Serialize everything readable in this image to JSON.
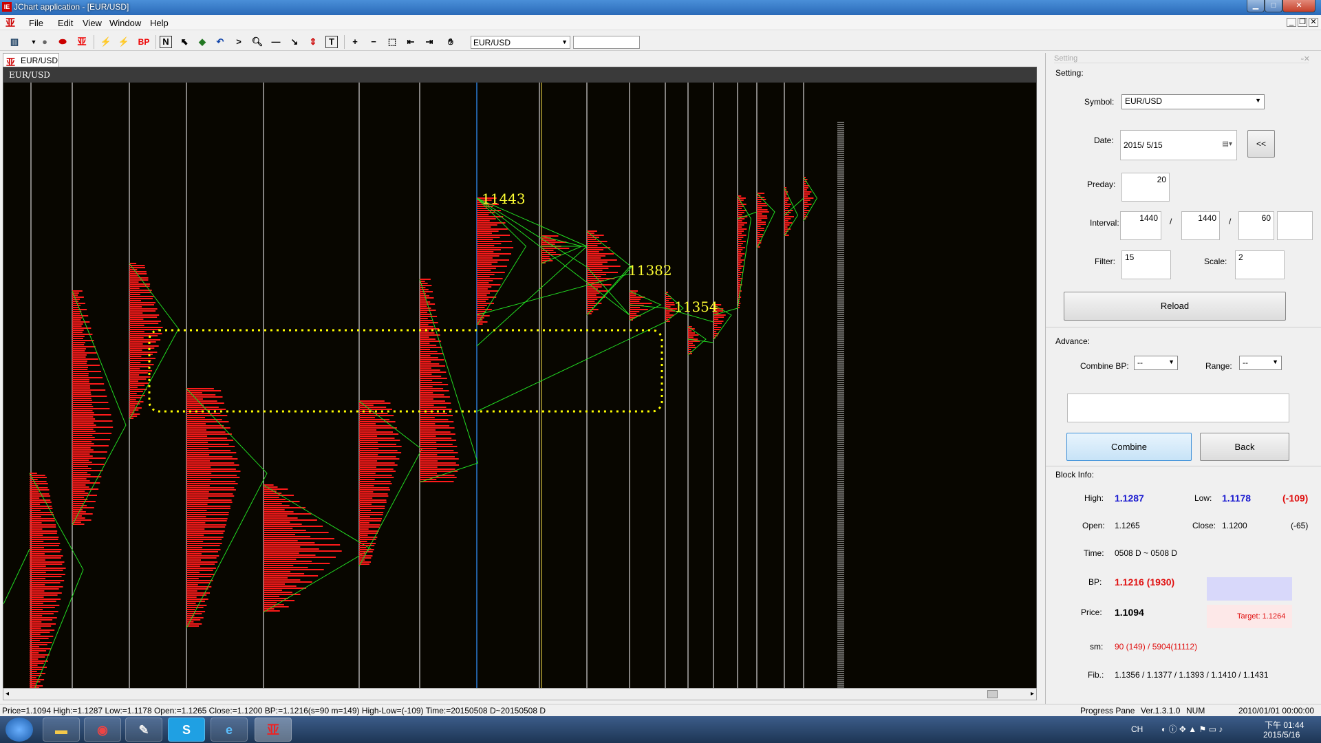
{
  "window": {
    "title": "JChart application - [EUR/USD]",
    "logo": "IE"
  },
  "menu": [
    "File",
    "Edit",
    "View",
    "Window",
    "Help"
  ],
  "toolbar": {
    "symbol": "EUR/USD",
    "input_value": "",
    "icons": [
      "chart-icon",
      "circle-icon",
      "stop-icon",
      "ie-icon",
      "lightning-icon",
      "lightning-red-icon",
      "bp-icon",
      "n-icon",
      "cursor-icon",
      "book-icon",
      "undo-icon",
      "arrow-icon",
      "zoom-icon",
      "hline-icon",
      "diag-line-icon",
      "fib-icon",
      "text-icon",
      "plus-icon",
      "minus-icon",
      "box-icon",
      "left-arrow-icon",
      "right-arrow-icon",
      "hand-icon"
    ],
    "bp_label": "BP",
    "n_label": "N",
    "t_label": "T"
  },
  "doc_tab": {
    "label": "EUR/USD"
  },
  "chart": {
    "header": "EUR/USD",
    "annotations": [
      {
        "text": "11443"
      },
      {
        "text": "11382"
      },
      {
        "text": "11354"
      }
    ],
    "colors": {
      "background": "#080600",
      "bars": "#ff1a1a",
      "lines": "#22dd22",
      "grid": "#ffffff",
      "highlight": "#ffff00",
      "current": "#2a7bd6",
      "annotation": "#ffff33"
    }
  },
  "panel": {
    "header": "Setting",
    "setting_label": "Setting:",
    "symbol_label": "Symbol:",
    "symbol_value": "EUR/USD",
    "date_label": "Date:",
    "date_value": "2015/  5/15",
    "date_back_button": "<<",
    "preday_label": "Preday:",
    "preday_value": "20",
    "interval_label": "Interval:",
    "interval_values": [
      "1440",
      "1440",
      "60",
      ""
    ],
    "interval_sep": "/",
    "filter_label": "Filter:",
    "filter_value": "15",
    "scale_label": "Scale:",
    "scale_value": "2",
    "reload_button": "Reload",
    "advance_label": "Advance:",
    "combine_bp_label": "Combine BP:",
    "combine_bp_value": "--",
    "range_label": "Range:",
    "range_value": "--",
    "combine_button": "Combine",
    "back_button": "Back",
    "block_info_label": "Block Info:",
    "high_label": "High:",
    "high_value": "1.1287",
    "low_label": "Low:",
    "low_value": "1.1178",
    "low_diff": "(-109)",
    "open_label": "Open:",
    "open_value": "1.1265",
    "close_label": "Close:",
    "close_value": "1.1200",
    "close_diff": "(-65)",
    "time_label": "Time:",
    "time_value": "0508 D ~ 0508 D",
    "bp_label": "BP:",
    "bp_value": "1.1216 (1930)",
    "price_label": "Price:",
    "price_value": "1.1094",
    "target_value": "Target: 1.1264",
    "sm_label": "sm:",
    "sm_value": "90 (149) / 5904(11112)",
    "fib_label": "Fib.:",
    "fib_value": "1.1356 / 1.1377 / 1.1393 / 1.1410 / 1.1431"
  },
  "status": {
    "left": "Price=1.1094  High:=1.1287  Low:=1.1178  Open:=1.1265  Close:=1.1200  BP:=1.1216(s=90 m=149)  High-Low=(-109)  Time:=20150508 D~20150508 D",
    "progress": "Progress Pane",
    "version": "Ver.1.3.1.0",
    "num": "NUM",
    "datetime": "2010/01/01 00:00:00"
  },
  "taskbar": {
    "apps": [
      "folder-icon",
      "chrome-icon",
      "notepad-icon",
      "skype-icon",
      "ie-browser-icon",
      "jchart-icon"
    ],
    "lang": "CH",
    "time": "下午 01:44",
    "date": "2015/5/16"
  }
}
